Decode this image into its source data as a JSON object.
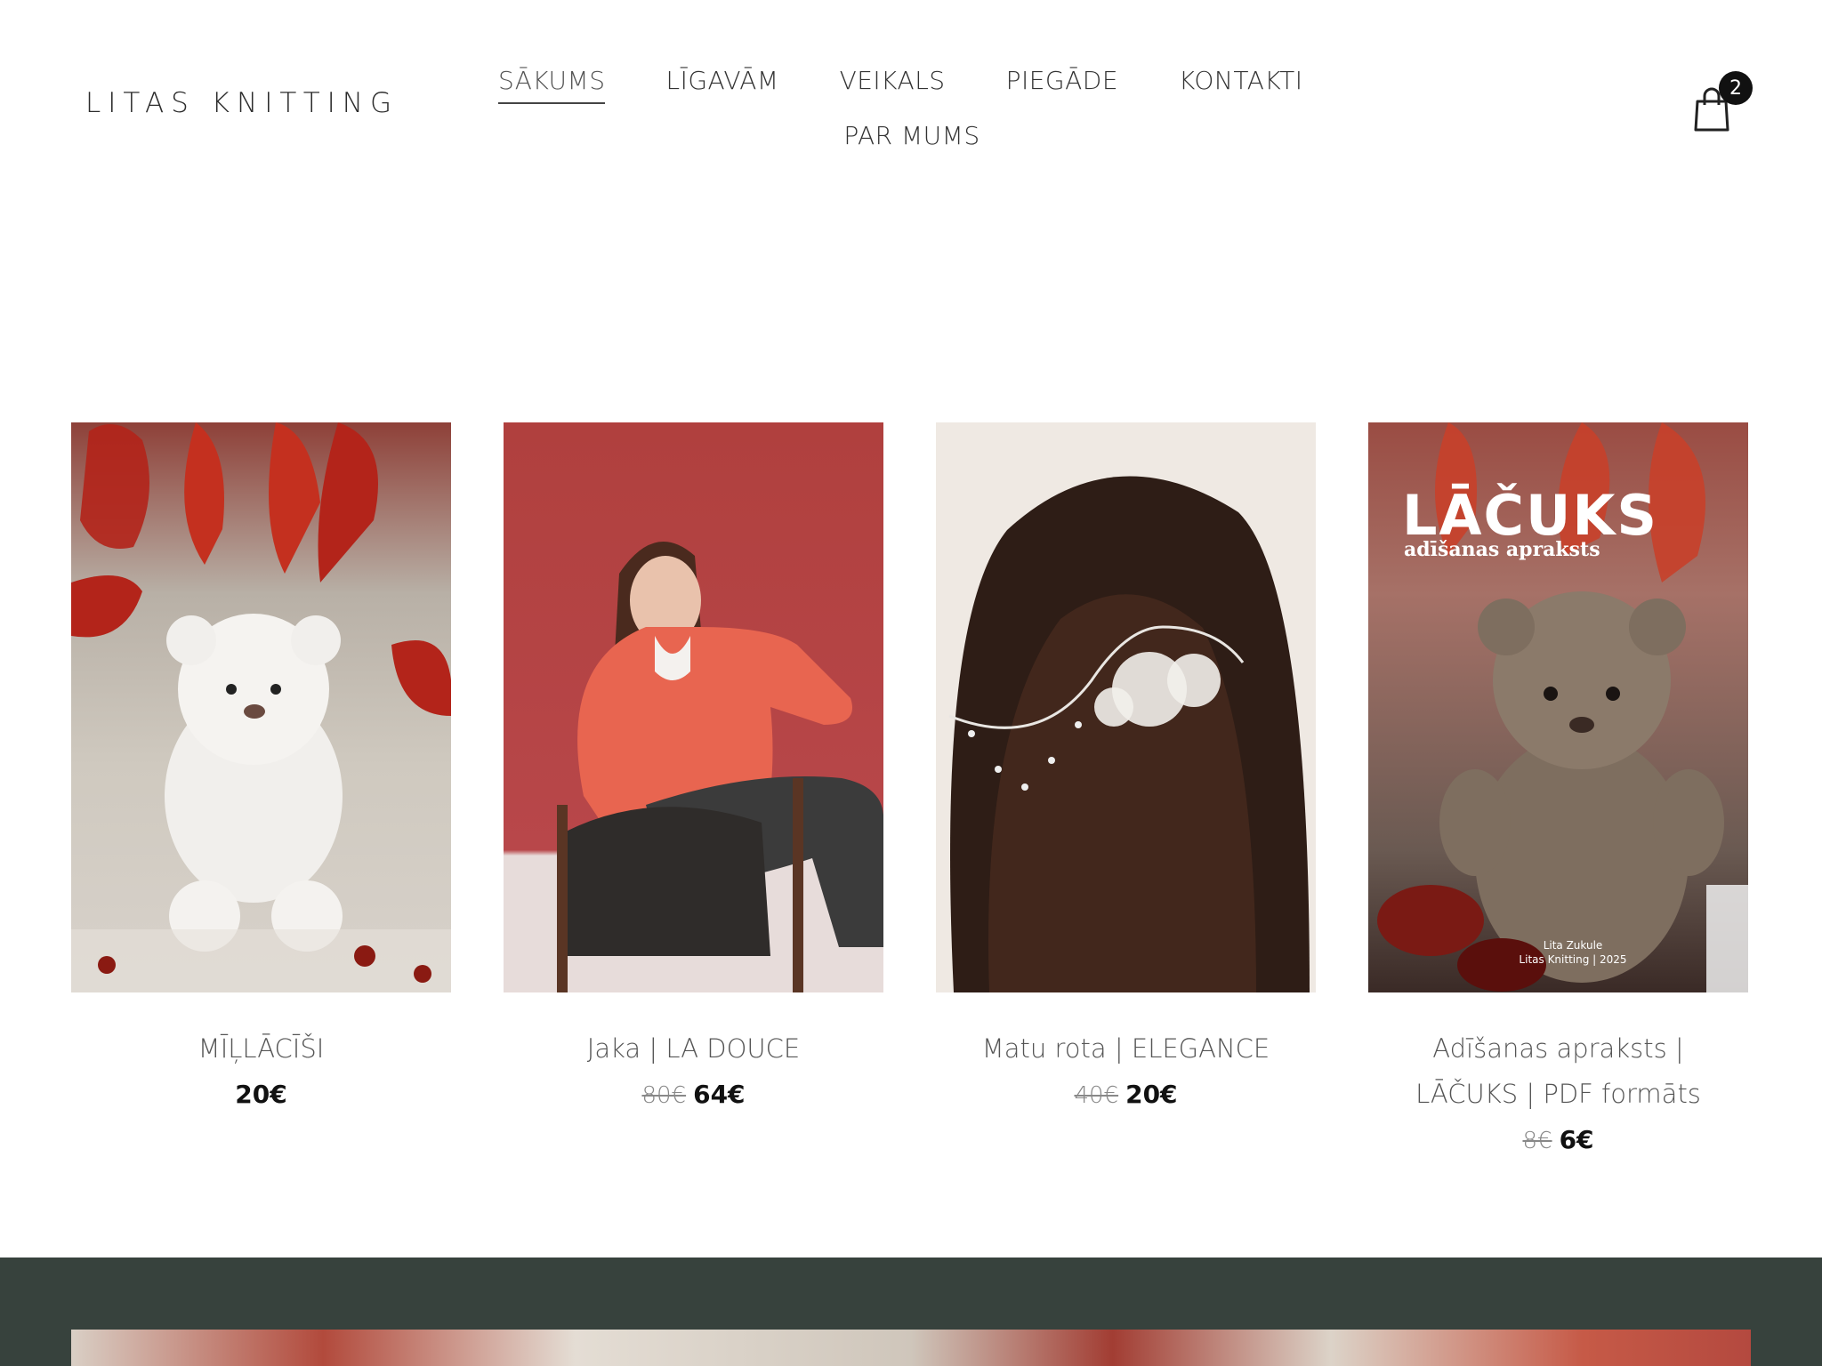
{
  "header": {
    "logo": "LITAS KNITTING",
    "nav": [
      {
        "label": "SĀKUMS",
        "active": true
      },
      {
        "label": "LĪGAVĀM",
        "active": false
      },
      {
        "label": "VEIKALS",
        "active": false
      },
      {
        "label": "PIEGĀDE",
        "active": false
      },
      {
        "label": "KONTAKTI",
        "active": false
      },
      {
        "label": "PAR MUMS",
        "active": false
      }
    ],
    "cart_count": "2",
    "cart_icon": "shopping-bag-icon"
  },
  "products": [
    {
      "title": "MĪĻLĀCĪŠI",
      "old_price": "",
      "price": "20€"
    },
    {
      "title": "Jaka | LA DOUCE",
      "old_price": "80€",
      "price": "64€"
    },
    {
      "title": "Matu rota | ELEGANCE",
      "old_price": "40€",
      "price": "20€"
    },
    {
      "title_line1": "Adīšanas apraksts |",
      "title_line2": "LĀČUKS | PDF formāts",
      "old_price": "8€",
      "price": "6€",
      "image_text": {
        "title": "LĀČUKS",
        "subtitle": "adīšanas apraksts",
        "credit_line1": "Lita Zukule",
        "credit_line2": "Litas Knitting | 2025"
      }
    }
  ],
  "colors": {
    "footer_band": "#37423d",
    "text": "#555555",
    "price": "#111111"
  }
}
